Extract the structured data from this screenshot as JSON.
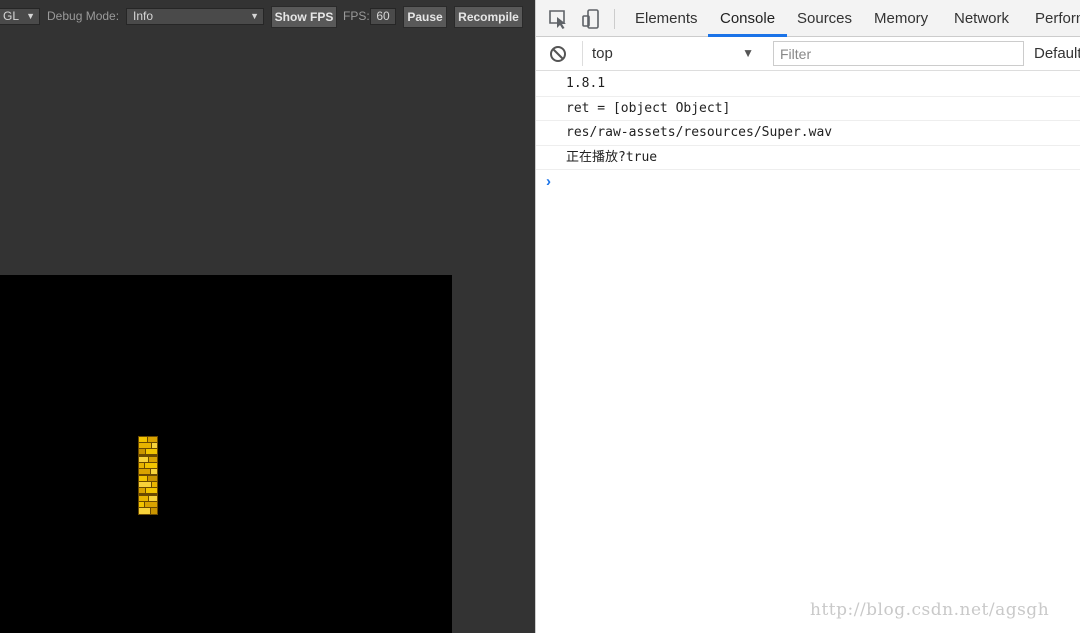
{
  "preview": {
    "renderer_select": "GL",
    "debug_mode_label": "Debug Mode:",
    "debug_mode_value": "Info",
    "show_fps_button": "Show FPS",
    "fps_label": "FPS:",
    "fps_value": "60",
    "pause_button": "Pause",
    "recompile_button": "Recompile",
    "canvas_color": "#000000"
  },
  "devtools": {
    "tabs": [
      {
        "label": "Elements",
        "active": false
      },
      {
        "label": "Console",
        "active": true
      },
      {
        "label": "Sources",
        "active": false
      },
      {
        "label": "Memory",
        "active": false
      },
      {
        "label": "Network",
        "active": false
      },
      {
        "label": "Perform",
        "active": false
      }
    ],
    "icons": {
      "inspect": "inspect-element-icon",
      "device": "device-toolbar-icon",
      "clear": "clear-console-icon",
      "prompt": "chevron-right-icon"
    },
    "console": {
      "context": "top",
      "filter_placeholder": "Filter",
      "levels": "Default",
      "lines": [
        "1.8.1",
        "ret = [object Object]",
        "res/raw-assets/resources/Super.wav",
        "正在播放?true"
      ],
      "prompt_symbol": "›"
    },
    "accent_color": "#1a73e8"
  },
  "watermark": "http://blog.csdn.net/agsgh"
}
